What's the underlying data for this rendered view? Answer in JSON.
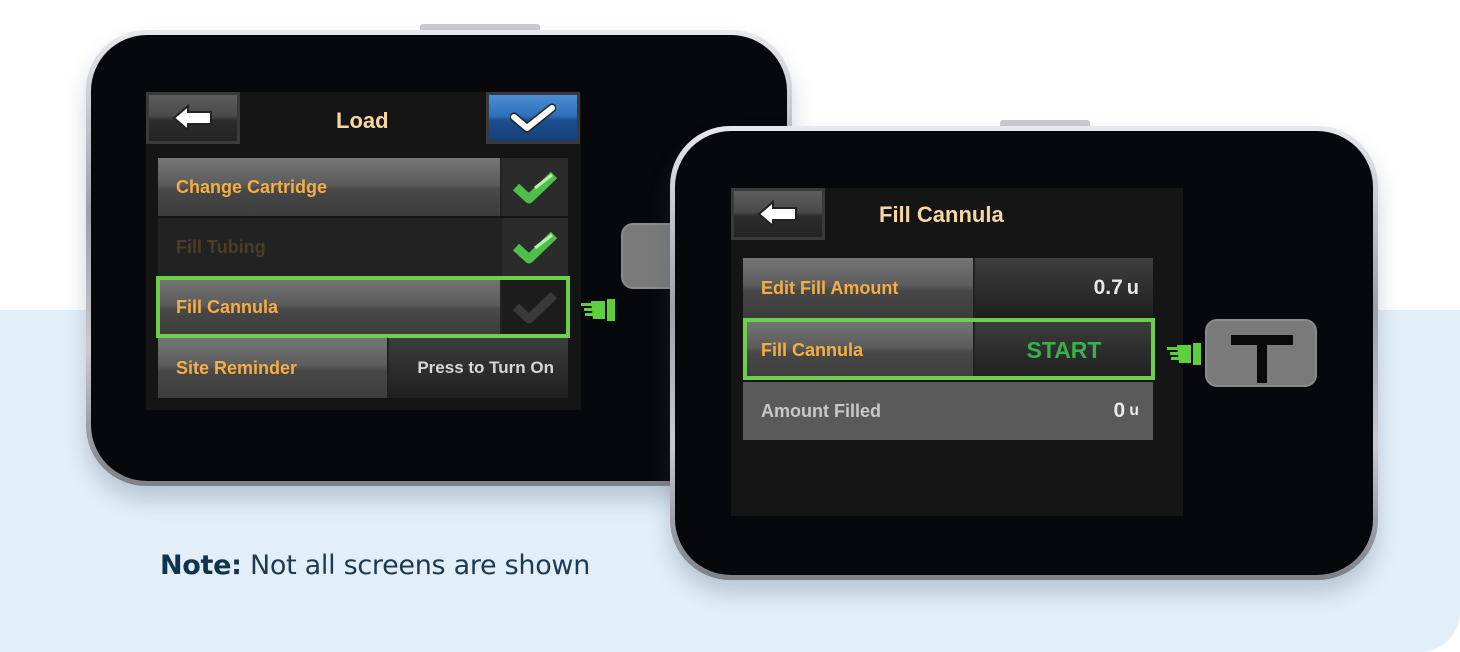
{
  "note": {
    "label": "Note:",
    "text": " Not all screens are shown"
  },
  "screen_load": {
    "title": "Load",
    "back_icon": "arrow-left-icon",
    "confirm_icon": "checkmark-icon",
    "rows": [
      {
        "label": "Change Cartridge",
        "status": "complete"
      },
      {
        "label": "Fill Tubing",
        "status": "complete"
      },
      {
        "label": "Fill Cannula",
        "status": "pending"
      },
      {
        "label": "Site Reminder",
        "value": "Press to Turn On"
      }
    ]
  },
  "screen_fill_cannula": {
    "title": "Fill Cannula",
    "back_icon": "arrow-left-icon",
    "rows": [
      {
        "label": "Edit Fill Amount",
        "value": "0.7",
        "unit": "u"
      },
      {
        "label": "Fill Cannula",
        "value": "START"
      },
      {
        "label": "Amount Filled",
        "value": "0",
        "unit": "u"
      }
    ]
  },
  "colors": {
    "highlight": "#6dd04a",
    "label_orange": "#f4ae43",
    "start_green": "#36b24b",
    "confirm_blue": "#2f6fb8",
    "note_navy": "#0f3450"
  }
}
